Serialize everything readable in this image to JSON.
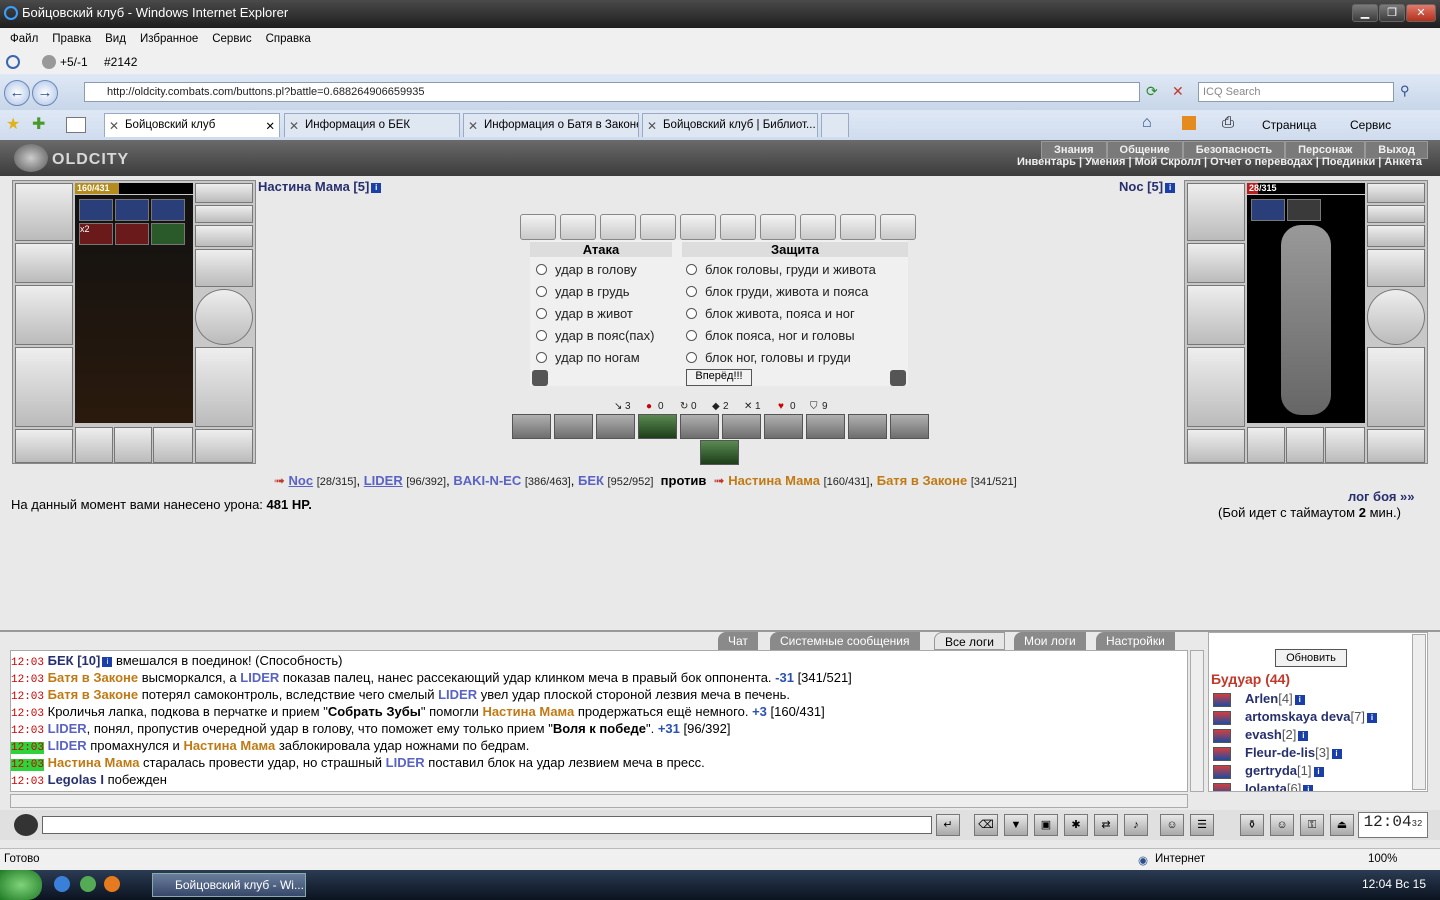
{
  "window": {
    "title": "Бойцовский клуб - Windows Internet Explorer",
    "min": "▁",
    "max": "❐",
    "close": "✕"
  },
  "menu": [
    "Файл",
    "Правка",
    "Вид",
    "Избранное",
    "Сервис",
    "Справка"
  ],
  "toolbar1": {
    "a": "+5/-1",
    "b": "#2142"
  },
  "address": {
    "url": "http://oldcity.combats.com/buttons.pl?battle=0.688264906659935",
    "search_placeholder": "ICQ Search"
  },
  "tabs": [
    {
      "label": "Бойцовский клуб",
      "active": true
    },
    {
      "label": "Информация о БЕК"
    },
    {
      "label": "Информация о Батя в Законе"
    },
    {
      "label": "Бойцовский клуб | Библиот..."
    }
  ],
  "ie_toolbar": {
    "page": "Страница",
    "service": "Сервис"
  },
  "game": {
    "logo": "OLDCITY",
    "topnav": [
      "Знания",
      "Общение",
      "Безопасность",
      "Персонаж",
      "Выход"
    ],
    "subnav": "Инвентарь | Умения | Мой Скролл | Отчет о переводах | Поединки | Анкета"
  },
  "player_left": {
    "name": "Настина Мама [5]",
    "hp": "160/431",
    "hp_pct": 37.1,
    "badge": "x2"
  },
  "player_right": {
    "name": "Noc [5]",
    "hp": "28/315",
    "hp_pct": 8.9
  },
  "attack": {
    "title": "Атака",
    "options": [
      "удар в голову",
      "удар в грудь",
      "удар в живот",
      "удар в пояс(пах)",
      "удар по ногам"
    ]
  },
  "defense": {
    "title": "Защита",
    "options": [
      "блок головы, груди и живота",
      "блок груди, живота и пояса",
      "блок живота, пояса и ног",
      "блок пояса, ног и головы",
      "блок ног, головы и груди"
    ]
  },
  "forward_button": "Вперёд!!!",
  "stats": [
    "3",
    "0",
    "0",
    "2",
    "1",
    "0",
    "9"
  ],
  "teams": {
    "left": [
      {
        "name": "Noc",
        "hp": "[28/315]"
      },
      {
        "name": "LIDER",
        "hp": "[96/392]"
      },
      {
        "name": "BAKI-N-EC",
        "hp": "[386/463]"
      },
      {
        "name": "БЕК",
        "hp": "[952/952]"
      }
    ],
    "vs": "против",
    "right": [
      {
        "name": "Настина Мама",
        "hp": "[160/431]"
      },
      {
        "name": "Батя в Законе",
        "hp": "[341/521]"
      }
    ]
  },
  "damage": {
    "text": "На данный момент вами нанесено урона:",
    "value": "481 HP."
  },
  "battle_log_link": "лог боя »»",
  "timeout": {
    "pre": "(Бой идет с таймаутом",
    "value": "2",
    "post": "мин.)"
  },
  "chat_tabs": [
    "Чат",
    "Системные сообщения",
    "Все логи",
    "Мои логи",
    "Настройки"
  ],
  "chat": [
    {
      "time": "12:03",
      "html": "<b style='color:#27306e'>БЕК [10]</b><span class='info-i'>i</span> вмешался в поединок! (Способность)"
    },
    {
      "time": "12:03",
      "html": "<span class='brown'>Батя в Законе</span> высморкался, а <span class='blue'>LIDER</span> показав палец, нанес рассекающий удар клинком меча в правый бок оппонента. <b style='color:#2a50b4'>-31</b> [341/521]"
    },
    {
      "time": "12:03",
      "html": "<span class='brown'>Батя в Законе</span> потерял самоконтроль, вследствие чего смелый <span class='blue'>LIDER</span> увел удар плоской стороной лезвия меча в печень."
    },
    {
      "time": "12:03",
      "html": "Кроличья лапка, подкова в перчатке и прием \"<b>Собрать Зубы</b>\" помогли <span class='brown'>Настина Мама</span> продержаться ещё немного. <b style='color:#2a50b4'>+3</b> [160/431]"
    },
    {
      "time": "12:03",
      "html": "<span class='blue'>LIDER</span>, понял, пропустив очередной удар в голову, что поможет ему только прием \"<b>Воля к победе</b>\". <b style='color:#2a50b4'>+31</b> [96/392]"
    },
    {
      "time": "12:03",
      "green": true,
      "html": "<span class='blue'>LIDER</span> промахнулся и <span class='brown'>Настина Мама</span> заблокировала удар ножнами по бедрам."
    },
    {
      "time": "12:03",
      "green": true,
      "html": "<span class='brown'>Настина Мама</span> старалась провести удар, но страшный <span class='blue'>LIDER</span> поставил блок на удар лезвием меча в пресс."
    },
    {
      "time": "12:03",
      "html": "<b style='color:#27306e'>Legolas I</b> побежден"
    }
  ],
  "buduar": {
    "refresh": "Обновить",
    "title": "Будуар (44)",
    "users": [
      {
        "name": "Arlen",
        "lvl": "[4]"
      },
      {
        "name": "artomskaya deva",
        "lvl": "[7]"
      },
      {
        "name": "evash",
        "lvl": "[2]"
      },
      {
        "name": "Fleur-de-lis",
        "lvl": "[3]"
      },
      {
        "name": "gertryda",
        "lvl": "[1]"
      },
      {
        "name": "Iolanta",
        "lvl": "[6]"
      }
    ]
  },
  "clock": {
    "time": "12:04",
    "sec": "32",
    "c": "CLOCK",
    "t": "TIMER"
  },
  "status": {
    "left": "Готово",
    "zone": "Интернет",
    "zoom": "100%"
  },
  "taskbar": {
    "item": "Бойцовский клуб - Wi...",
    "time": "12:04 Вс 15"
  }
}
